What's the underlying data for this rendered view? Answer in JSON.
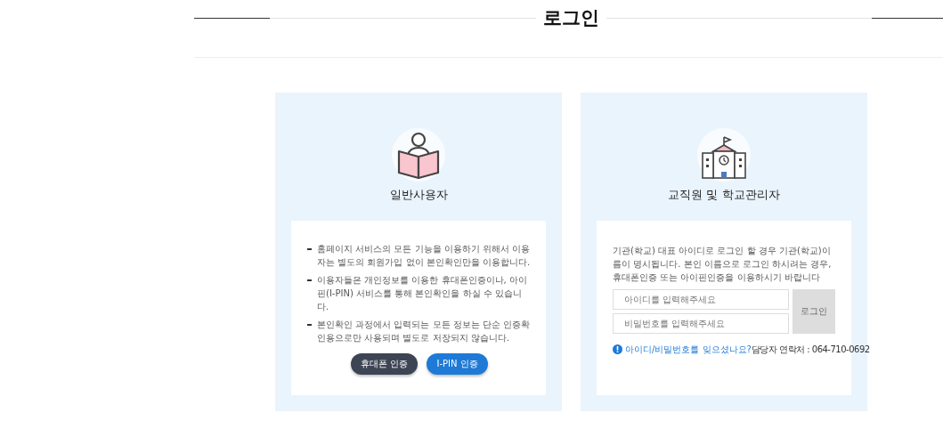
{
  "title": "로그인",
  "general": {
    "heading": "일반사용자",
    "notes": [
      "홈페이지 서비스의 모든 기능을 이용하기 위해서 이용자는 별도의 회원가입 없이 본인확인만을 이용합니다.",
      "이용자들은 개인정보를 이용한 휴대폰인증이나, 아이핀(I-PIN) 서비스를 통해 본인확인을 하실 수 있습니다.",
      "본인확인 과정에서 입력되는 모든 정보는 단순 인증확인용으로만 사용되며 별도로 저장되지 않습니다."
    ],
    "buttons": [
      {
        "label": "휴대폰 인증",
        "kind": "phone"
      },
      {
        "label": "I-PIN 인증",
        "kind": "ipin"
      }
    ]
  },
  "staff": {
    "heading": "교직원 및 학교관리자",
    "notice": "기관(학교) 대표 아이디로 로그인 할 경우 기관(학교)이름이 명시됩니다. 본인 이름으로 로그인 하시려는 경우,\n휴대폰인증 또는 아이핀인증을 이용하시기 바랍니다",
    "id_field": {
      "placeholder": "아이디를 입력해주세요"
    },
    "password_field": {
      "placeholder": "비밀번호를 입력해주세요"
    },
    "login_button": "로그인",
    "forgot_link": "아이디/비밀번호를 잊으셨나요?",
    "contact": "담당자 연락처 : 064-710-0692"
  }
}
